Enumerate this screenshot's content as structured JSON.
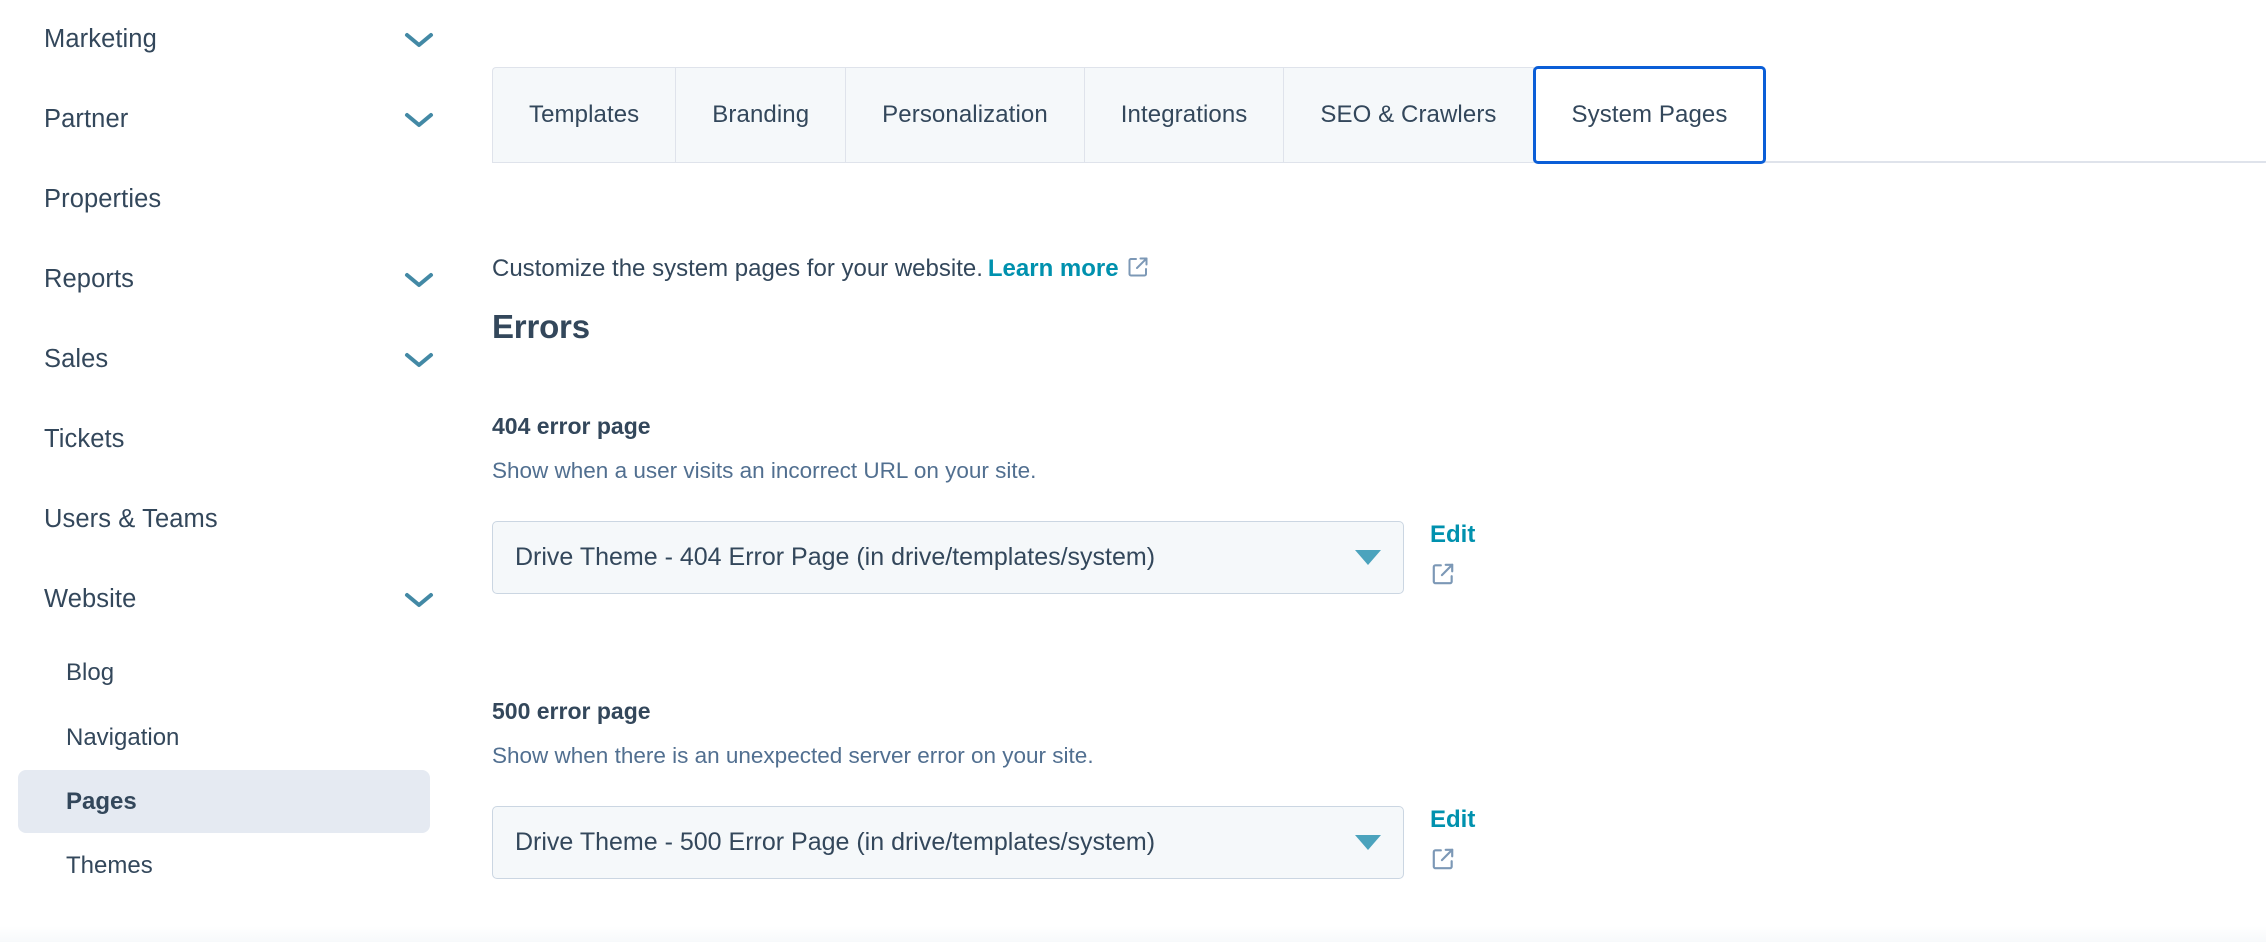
{
  "sidebar": {
    "items": [
      {
        "label": "Marketing",
        "type": "parent",
        "expandable": true,
        "icon": "chevron-down-icon"
      },
      {
        "label": "Partner",
        "type": "parent",
        "expandable": true,
        "icon": "chevron-down-icon"
      },
      {
        "label": "Properties",
        "type": "parent",
        "expandable": false,
        "icon": ""
      },
      {
        "label": "Reports",
        "type": "parent",
        "expandable": true,
        "icon": "chevron-down-icon"
      },
      {
        "label": "Sales",
        "type": "parent",
        "expandable": true,
        "icon": "chevron-down-icon"
      },
      {
        "label": "Tickets",
        "type": "parent",
        "expandable": false,
        "icon": ""
      },
      {
        "label": "Users & Teams",
        "type": "parent",
        "expandable": false,
        "icon": ""
      },
      {
        "label": "Website",
        "type": "parent",
        "expandable": true,
        "icon": "chevron-down-icon"
      },
      {
        "label": "Blog",
        "type": "child",
        "active": false
      },
      {
        "label": "Navigation",
        "type": "child",
        "active": false
      },
      {
        "label": "Pages",
        "type": "child",
        "active": true
      },
      {
        "label": "Themes",
        "type": "child",
        "active": false
      }
    ]
  },
  "tabs": [
    {
      "label": "Templates",
      "active": false
    },
    {
      "label": "Branding",
      "active": false
    },
    {
      "label": "Personalization",
      "active": false
    },
    {
      "label": "Integrations",
      "active": false
    },
    {
      "label": "SEO & Crawlers",
      "active": false
    },
    {
      "label": "System Pages",
      "active": true
    }
  ],
  "main": {
    "intro_text": "Customize the system pages for your website.",
    "learn_more_label": "Learn more",
    "learn_more_icon": "external-link-icon",
    "section_title": "Errors",
    "fields": [
      {
        "title": "404 error page",
        "description": "Show when a user visits an incorrect URL on your site.",
        "select_value": "Drive Theme - 404 Error Page (in drive/templates/system)",
        "edit_label": "Edit",
        "preview_icon": "external-link-icon"
      },
      {
        "title": "500 error page",
        "description": "Show when there is an unexpected server error on your site.",
        "select_value": "Drive Theme - 500 Error Page (in drive/templates/system)",
        "edit_label": "Edit",
        "preview_icon": "external-link-icon"
      }
    ]
  },
  "colors": {
    "text_primary": "#33475b",
    "text_secondary": "#516f90",
    "link": "#0091ae",
    "accent_teal": "#4ba3bd",
    "tab_active_border": "#0b5ed7",
    "surface_light": "#f5f8fa",
    "border": "#cbd6e2",
    "active_nav_bg": "#e5eaf2"
  }
}
